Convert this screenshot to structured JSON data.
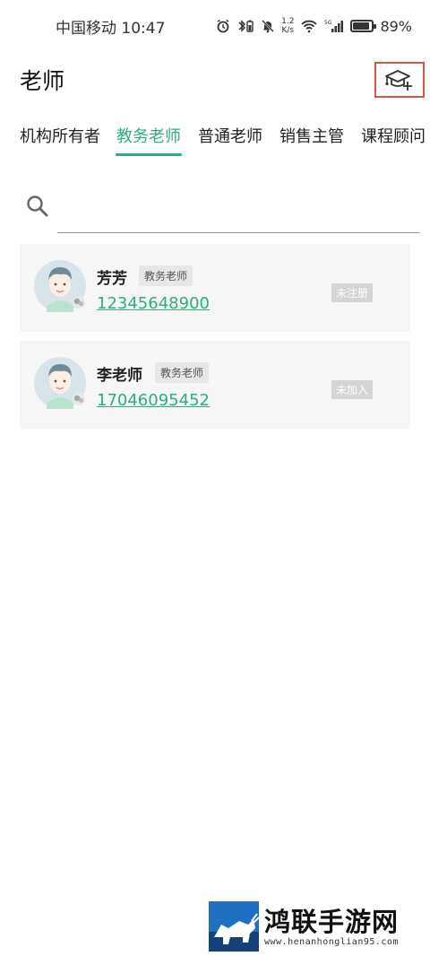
{
  "status_bar": {
    "carrier_time": "中国移动 10:47",
    "speed_value": "1.2",
    "speed_unit": "K/s",
    "network": "5G",
    "battery": "89%",
    "battery_level": 0.89
  },
  "header": {
    "title": "老师",
    "add_icon": "graduation-cap-plus-icon"
  },
  "tabs": [
    {
      "label": "机构所有者",
      "active": false
    },
    {
      "label": "教务老师",
      "active": true
    },
    {
      "label": "普通老师",
      "active": false
    },
    {
      "label": "销售主管",
      "active": false
    },
    {
      "label": "课程顾问",
      "active": false
    }
  ],
  "search": {
    "icon": "search-icon",
    "placeholder": ""
  },
  "teachers": [
    {
      "name": "芳芳",
      "role": "教务老师",
      "phone": "12345648900",
      "status": "未注册"
    },
    {
      "name": "李老师",
      "role": "教务老师",
      "phone": "17046095452",
      "status": "未加入"
    }
  ],
  "watermark": {
    "title": "鸿联手游网",
    "url": "www.henanhonglian95.com"
  },
  "colors": {
    "accent": "#2bb07a",
    "highlight_border": "#d9553e",
    "card_bg": "#f6f6f6"
  }
}
